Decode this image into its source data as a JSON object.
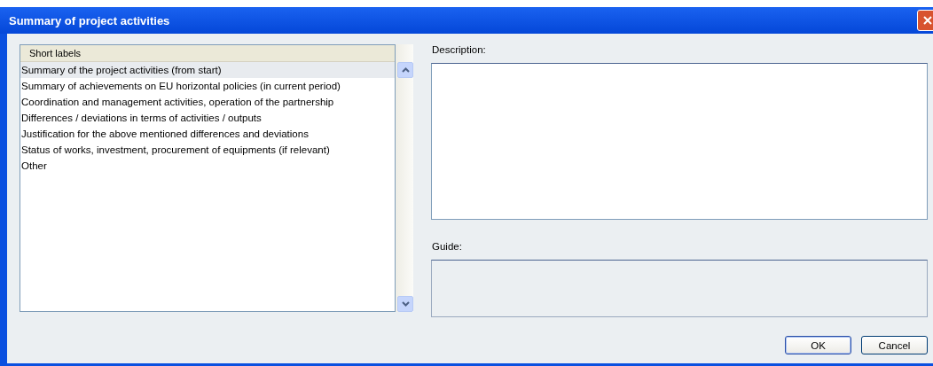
{
  "window": {
    "title": "Summary of project activities"
  },
  "list": {
    "header": "Short labels",
    "items": [
      {
        "label": "Summary of the project activities (from start)",
        "selected": true
      },
      {
        "label": "Summary of achievements on EU horizontal policies (in current period)",
        "selected": false
      },
      {
        "label": "Coordination and management activities, operation of the partnership",
        "selected": false
      },
      {
        "label": "Differences / deviations in terms of activities / outputs",
        "selected": false
      },
      {
        "label": "Justification for the above mentioned differences and deviations",
        "selected": false
      },
      {
        "label": "Status of works, investment, procurement of equipments (if relevant)",
        "selected": false
      },
      {
        "label": "Other",
        "selected": false
      }
    ]
  },
  "description": {
    "label": "Description:"
  },
  "guide": {
    "label": "Guide:"
  },
  "buttons": [
    {
      "label": "OK",
      "kind": "default"
    },
    {
      "label": "Cancel",
      "kind": "normal"
    }
  ]
}
